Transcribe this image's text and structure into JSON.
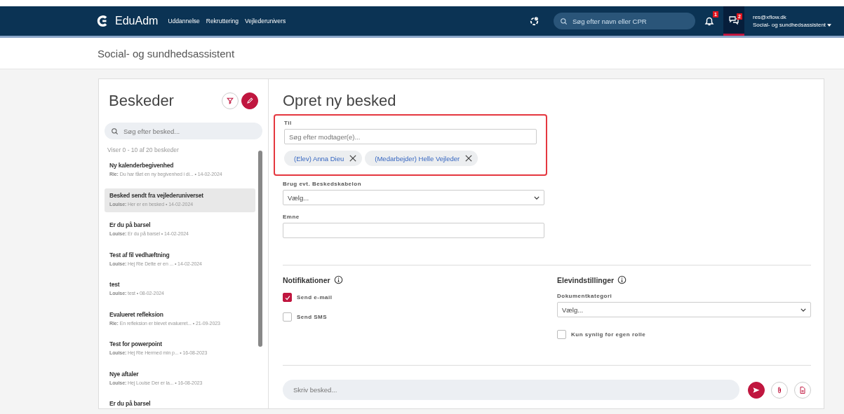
{
  "nav": {
    "logo": "EduAdm",
    "links": [
      "Uddannelse",
      "Rekruttering",
      "Vejlederunivers"
    ],
    "search": {
      "placeholder": "Søg efter navn eller CPR"
    },
    "notifications_badge": "1",
    "messages_badge": "2",
    "user": {
      "email": "res@xflow.dk",
      "role": "Social- og sundhedsassistent"
    }
  },
  "page_title": "Social- og sundhedsassistent",
  "inbox": {
    "title": "Beskeder",
    "search": {
      "placeholder": "Søg efter besked..."
    },
    "count": "Viser 0 - 10 af 20 beskeder",
    "messages": [
      {
        "subject": "Ny kalenderbegivenhed",
        "summary": "**Rie:** Du har fået en ny begivenhed i di... • 14-02-2024",
        "selected": false
      },
      {
        "subject": "Besked sendt fra vejlederuniverset",
        "summary": "**Louise:** Her er en besked • 14-02-2024",
        "selected": true
      },
      {
        "subject": "Er du på barsel",
        "summary": "**Louise:** Er du på barsel • 14-02-2024",
        "selected": false
      },
      {
        "subject": "Test af fil vedhæftning",
        "summary": "**Louise:** Hej Rie Dette er en ... • 14-02-2024",
        "selected": false
      },
      {
        "subject": "test",
        "summary": "**Louise:** test • 08-02-2024",
        "selected": false
      },
      {
        "subject": "Evalueret refleksion",
        "summary": "**Rie:** En refleksion er blevet evalueret... • 21-09-2023",
        "selected": false
      },
      {
        "subject": "Test for powerpoint",
        "summary": "**Louise:** Hej Rie Hermed min p... • 16-08-2023",
        "selected": false
      },
      {
        "subject": "Nye aftaler",
        "summary": "**Louise:** Hej Louise Der er la... • 16-08-2023",
        "selected": false
      },
      {
        "subject": "Er du på barsel",
        "selected": false
      }
    ]
  },
  "compose": {
    "title": "Opret ny besked",
    "to": {
      "label": "Til",
      "placeholder": "Søg efter modtager(e)...",
      "recipients": [
        "(Elev) Anna Dieu",
        "(Medarbejder) Helle Vejleder"
      ]
    },
    "template": {
      "label": "Brug evt. Beskedskabelon",
      "value": "Vælg..."
    },
    "subject": {
      "label": "Emne"
    },
    "notifications": {
      "title": "Notifikationer",
      "options": [
        {
          "label": "Send e-mail",
          "checked": true
        },
        {
          "label": "Send SMS",
          "checked": false
        }
      ]
    },
    "student_settings": {
      "title": "Elevindstillinger",
      "category": {
        "label": "Dokumentkategori",
        "value": "Vælg..."
      },
      "options": [
        {
          "label": "Kun synlig for egen rolle",
          "checked": false
        }
      ]
    },
    "message": {
      "placeholder": "Skriv besked..."
    }
  }
}
